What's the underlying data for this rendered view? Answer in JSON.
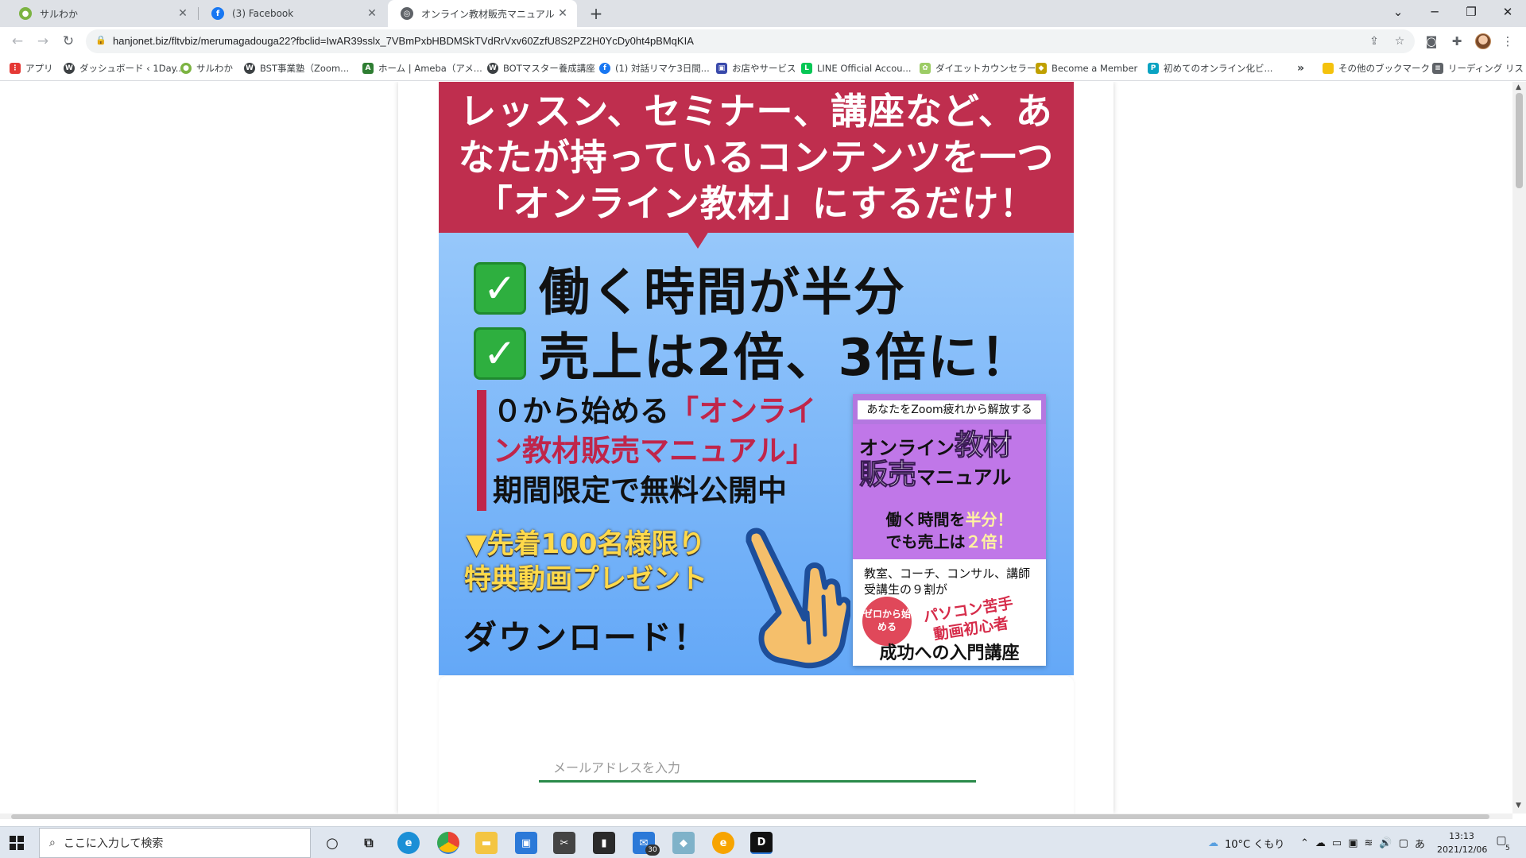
{
  "tabs": [
    {
      "title": "サルわか",
      "icon": "saruwaka-favicon"
    },
    {
      "title": "(3) Facebook",
      "icon": "facebook-favicon"
    },
    {
      "title": "オンライン教材販売マニュアル | FLTV",
      "icon": "globe-favicon"
    }
  ],
  "address": {
    "url": "hanjonet.biz/fltvbiz/merumagadouga22?fbclid=IwAR39sslx_7VBmPxbHBDMSkTVdRrVxv60ZzfU8S2PZ2H0YcDy0ht4pBMqKIA"
  },
  "bookmarks": [
    {
      "label": "アプリ"
    },
    {
      "label": "ダッシュボード ‹ 1Day..."
    },
    {
      "label": "サルわか"
    },
    {
      "label": "BST事業塾（Zoom..."
    },
    {
      "label": "ホーム | Ameba（アメ..."
    },
    {
      "label": "BOTマスター養成講座"
    },
    {
      "label": "(1) 対話リマケ3日間..."
    },
    {
      "label": "お店やサービス"
    },
    {
      "label": "LINE Official Accou..."
    },
    {
      "label": "ダイエットカウンセラー..."
    },
    {
      "label": "Become a Member"
    },
    {
      "label": "初めてのオンライン化ビ..."
    },
    {
      "label": "その他のブックマーク"
    },
    {
      "label": "リーディング リスト"
    }
  ],
  "banner": {
    "headline_lines": [
      "レッスン、セミナー、講座など、あ",
      "なたが持っているコンテンツを一つ",
      "「オンライン教材」にするだけ！"
    ],
    "check_1": "働く時間が半分",
    "check_2": "売上は2倍、3倍に！",
    "free_line1_a": "０から始める",
    "free_line1_b": "「オンライ",
    "free_line2": "ン教材販売マニュアル」",
    "free_line3": "期間限定で無料公開中",
    "limited_line1": "▼先着100名様限り",
    "limited_line2": "特典動画プレゼント",
    "download": "ダウンロード！",
    "book": {
      "subtitle": "あなたをZoom疲れから解放する",
      "title_a": "オンライン",
      "title_b": "教材",
      "title_c": "販売",
      "title_d": "マニュアル",
      "tag_line1_a": "働く時間を",
      "tag_line1_b": "半分！",
      "tag_line2_a": "でも売上は",
      "tag_line2_b": "２倍！",
      "body_line1": "教室、コーチ、コンサル、講師",
      "body_line2": "受講生の９割が",
      "red_line1": "パソコン苦手",
      "red_line2": "動画初心者",
      "circle": "ゼロから始める",
      "footer": "成功への入門講座"
    }
  },
  "form": {
    "email_placeholder": "メールアドレスを入力"
  },
  "taskbar": {
    "search_placeholder": "ここに入力して検索",
    "mail_badge": "30",
    "weather": "10°C くもり",
    "ime": "あ",
    "time": "13:13",
    "date": "2021/12/06",
    "notifications": "5"
  },
  "colors": {
    "banner_red": "#bf2e4e",
    "banner_blue": "#8cc1fa",
    "book_purple": "#c077e8",
    "input_underline": "#2a8a4a"
  }
}
